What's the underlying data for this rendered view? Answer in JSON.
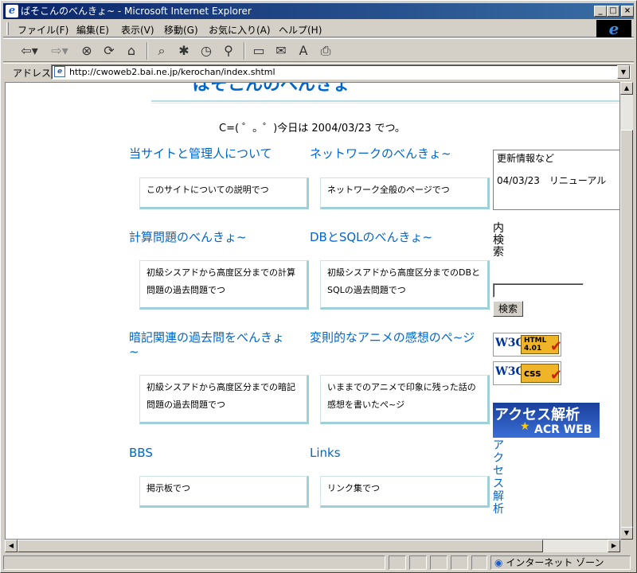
{
  "window": {
    "title": "ばそこんのべんきょ~ - Microsoft Internet Explorer",
    "minimize": "_",
    "maximize": "□",
    "close": "×"
  },
  "menu": [
    "ファイル(F)",
    "編集(E)",
    "表示(V)",
    "移動(G)",
    "お気に入り(A)",
    "ヘルプ(H)"
  ],
  "toolbar": {
    "back_icon": "back-arrow-icon",
    "forward_icon": "forward-arrow-icon",
    "stop_icon": "stop-icon",
    "refresh_icon": "refresh-icon",
    "home_icon": "home-icon",
    "search_icon": "search-icon",
    "favorites_icon": "favorites-icon",
    "history_icon": "history-icon",
    "channels_icon": "channels-icon",
    "fullscreen_icon": "fullscreen-icon",
    "mail_icon": "mail-icon",
    "font_icon": "font-icon",
    "print_icon": "print-icon"
  },
  "address": {
    "label": "アドレス",
    "url": "http://cwoweb2.bai.ne.jp/kerochan/index.shtml"
  },
  "page": {
    "hero_title": "ばそこんのべんきょ",
    "greeting": "C=( ゜。゜)今日は 2004/03/23 でつ。",
    "sections": [
      {
        "title": "当サイトと管理人について",
        "desc": "このサイトについての説明でつ"
      },
      {
        "title": "ネットワークのべんきょ~",
        "desc": "ネットワーク全般のページでつ"
      },
      {
        "title": "計算問題のべんきょ~",
        "desc": "初級シスアドから高度区分までの計算問題の過去問題でつ"
      },
      {
        "title": "DBとSQLのべんきょ~",
        "desc": "初級シスアドから高度区分までのDBとSQLの過去問題でつ"
      },
      {
        "title": "暗記関連の過去問をべんきょ~",
        "desc": "初級シスアドから高度区分までの暗記問題の過去問題でつ"
      },
      {
        "title": "変則的なアニメの感想のぺ~ジ",
        "desc": "いままでのアニメで印象に残った話の感想を書いたぺ~ジ"
      },
      {
        "title": "BBS",
        "desc": "掲示板でつ"
      },
      {
        "title": "Links",
        "desc": "リンク集でつ"
      }
    ],
    "news": {
      "heading": "更新情報など",
      "item": "04/03/23　リニューアル"
    },
    "search_label": "内検索",
    "search_button": "検索",
    "search_value": "",
    "badges": {
      "w3c": "W3C",
      "html": "HTML 4.01",
      "css": "css"
    },
    "acr": {
      "title": "アクセス解析",
      "sub": "ACR WEB",
      "link": "アクセス解析"
    }
  },
  "status": {
    "zone": "インターネット ゾーン"
  }
}
